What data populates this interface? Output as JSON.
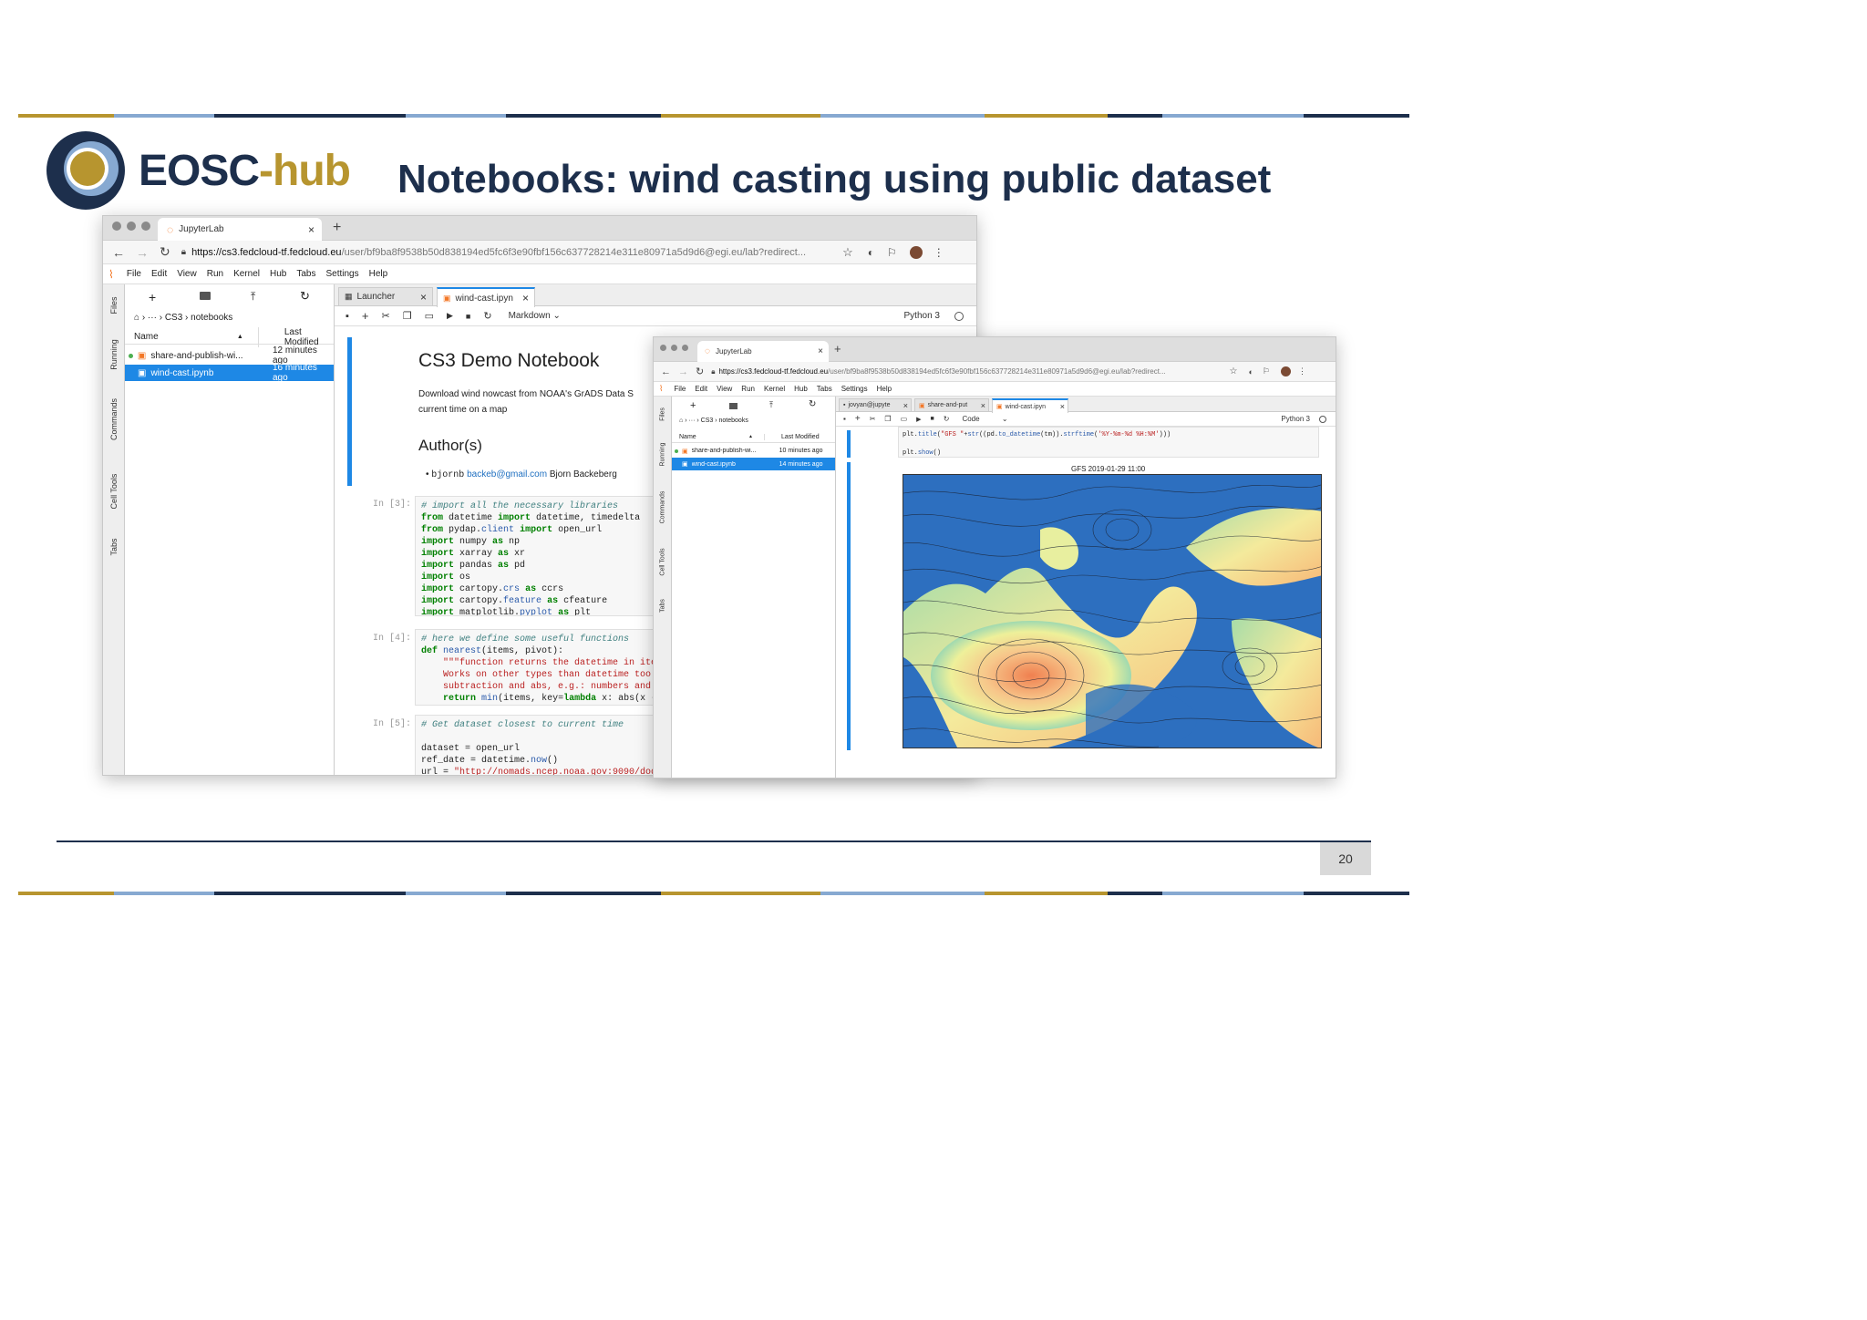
{
  "slide": {
    "title": "Notebooks: wind casting using public dataset",
    "logo_text_a": "EOSC",
    "logo_text_b": "-hub",
    "page_number": "20",
    "colors": {
      "navy": "#1d2f4c",
      "gold": "#b7952f",
      "blue": "#87a9d1"
    }
  },
  "back_window": {
    "browser_tab": "JupyterLab",
    "new_tab": "+",
    "url_host": "https://cs3.fedcloud-tf.fedcloud.eu",
    "url_path": "/user/bf9ba8f9538b50d838194ed5fc6f3e90fbf156c637728214e311e80971a5d9d6@egi.eu/lab?redirect...",
    "menu": [
      "File",
      "Edit",
      "View",
      "Run",
      "Kernel",
      "Hub",
      "Tabs",
      "Settings",
      "Help"
    ],
    "side_tabs": [
      "Files",
      "Running",
      "Commands",
      "Cell Tools",
      "Tabs"
    ],
    "breadcrumb": "› ··· › CS3 › notebooks",
    "col_name": "Name",
    "col_modified": "Last Modified",
    "files": [
      {
        "name": "share-and-publish-wi...",
        "modified": "12 minutes ago"
      },
      {
        "name": "wind-cast.ipynb",
        "modified": "16 minutes ago"
      }
    ],
    "nb_tabs": [
      "Launcher",
      "wind-cast.ipyn"
    ],
    "cell_type": "Markdown",
    "kernel": "Python 3",
    "nb_title": "CS3 Demo Notebook",
    "nb_desc_1": "Download wind nowcast from NOAA's GrADS Data S",
    "nb_desc_2": "current time on a map",
    "authors_heading": "Author(s)",
    "author_user": "bjornb",
    "author_email": "backeb@gmail.com",
    "author_name": "Bjorn Backeberg",
    "prompts": [
      "In [3]:",
      "In [4]:",
      "In [5]:"
    ]
  },
  "front_window": {
    "browser_tab": "JupyterLab",
    "new_tab": "+",
    "url_host": "https://cs3.fedcloud-tf.fedcloud.eu",
    "url_path": "/user/bf9ba8f9538b50d838194ed5fc6f3e90fbf156c637728214e311e80971a5d9d6@egi.eu/lab?redirect...",
    "menu": [
      "File",
      "Edit",
      "View",
      "Run",
      "Kernel",
      "Hub",
      "Tabs",
      "Settings",
      "Help"
    ],
    "side_tabs": [
      "Files",
      "Running",
      "Commands",
      "Cell Tools",
      "Tabs"
    ],
    "breadcrumb": "› ··· › CS3 › notebooks",
    "col_name": "Name",
    "col_modified": "Last Modified",
    "files": [
      {
        "name": "share-and-publish-wi...",
        "modified": "10 minutes ago"
      },
      {
        "name": "wind-cast.ipynb",
        "modified": "14 minutes ago"
      }
    ],
    "nb_tabs": [
      "jovyan@jupyte",
      "share-and-put",
      "wind-cast.ipyn"
    ],
    "cell_type": "Code",
    "kernel": "Python 3",
    "plot_title": "GFS 2019-01-29 11:00"
  }
}
